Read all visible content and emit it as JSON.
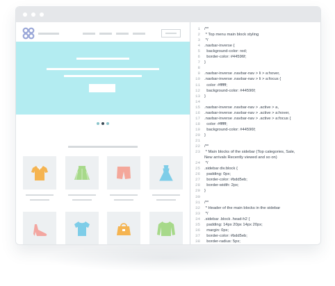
{
  "window": {
    "buttons": [
      "close",
      "minimize",
      "maximize"
    ]
  },
  "colors": {
    "titlebar": "#e5e7ea",
    "hero": "#b3ecf1",
    "logo": "#9aa7d8",
    "card": "#edf0f2",
    "placeholder": "#d6dadd"
  },
  "preview": {
    "logo_icon": "flower-logo-icon",
    "slider": {
      "slides": 3,
      "active_index": 1
    },
    "products": [
      {
        "icon": "polo-shirt-icon",
        "color": "#f5b451"
      },
      {
        "icon": "skirt-icon",
        "color": "#a7d98a"
      },
      {
        "icon": "shorts-icon",
        "color": "#f4a79a"
      },
      {
        "icon": "dress-icon",
        "color": "#7ecde8"
      },
      {
        "icon": "high-heel-icon",
        "color": "#f3a6a0"
      },
      {
        "icon": "t-shirt-icon",
        "color": "#7ecde8"
      },
      {
        "icon": "handbag-icon",
        "color": "#f5b451"
      },
      {
        "icon": "sweater-icon",
        "color": "#a7d98a"
      }
    ]
  },
  "code": {
    "lines": [
      {
        "n": "1",
        "t": "/**"
      },
      {
        "n": "2",
        "t": " * Top menu main block styling"
      },
      {
        "n": "3",
        "t": " */"
      },
      {
        "n": "4",
        "t": ".navbar-inverse {"
      },
      {
        "n": "5",
        "t": "  background-color: red;"
      },
      {
        "n": "6",
        "t": "  border-color: #44596f;"
      },
      {
        "n": "7",
        "t": "}"
      },
      {
        "n": "8",
        "t": ""
      },
      {
        "n": "9",
        "t": ".navbar-inverse .navbar-nav > li > a:hover,"
      },
      {
        "n": "10",
        "t": ".navbar-inverse .navbar-nav > li > a:focus {"
      },
      {
        "n": "11",
        "t": "  color: #ffffff;"
      },
      {
        "n": "12",
        "t": "  background-color: #44596f;"
      },
      {
        "n": "13",
        "t": "}"
      },
      {
        "n": "14",
        "t": ""
      },
      {
        "n": "15",
        "t": ".navbar-inverse .navbar-nav > .active > a,"
      },
      {
        "n": "16",
        "t": ".navbar-inverse .navbar-nav > .active > a:hover,"
      },
      {
        "n": "17",
        "t": ".navbar-inverse .navbar-nav > .active > a:focus {"
      },
      {
        "n": "18",
        "t": "  color: #ffffff;"
      },
      {
        "n": "19",
        "t": "  background-color: #44596f;"
      },
      {
        "n": "20",
        "t": "}"
      },
      {
        "n": "21",
        "t": ""
      },
      {
        "n": "22",
        "t": "/**"
      },
      {
        "n": "23",
        "t": " * Main blocks of the sidebar (Top categories, Sale,"
      },
      {
        "n": "",
        "t": "New arrivals Recently viewed and so on)"
      },
      {
        "n": "24",
        "t": " */"
      },
      {
        "n": "25",
        "t": ".sidebar div.block {"
      },
      {
        "n": "26",
        "t": "  padding: 0px;"
      },
      {
        "n": "27",
        "t": "  border-color: #bdd5eb;"
      },
      {
        "n": "28",
        "t": "  border-width: 2px;"
      },
      {
        "n": "29",
        "t": "}"
      },
      {
        "n": "30",
        "t": ""
      },
      {
        "n": "31",
        "t": "/**"
      },
      {
        "n": "32",
        "t": " * Header of the main blocks in the sidebar"
      },
      {
        "n": "33",
        "t": " */"
      },
      {
        "n": "34",
        "t": ".sidebar .block .head-h2 {"
      },
      {
        "n": "35",
        "t": "  padding: 14px 20px 14px 20px;"
      },
      {
        "n": "36",
        "t": "  margin: 0px;"
      },
      {
        "n": "37",
        "t": "  border-color: #bdd5eb;"
      },
      {
        "n": "38",
        "t": "  border-radius: 5px;"
      },
      {
        "n": "39",
        "t": ""
      }
    ]
  }
}
